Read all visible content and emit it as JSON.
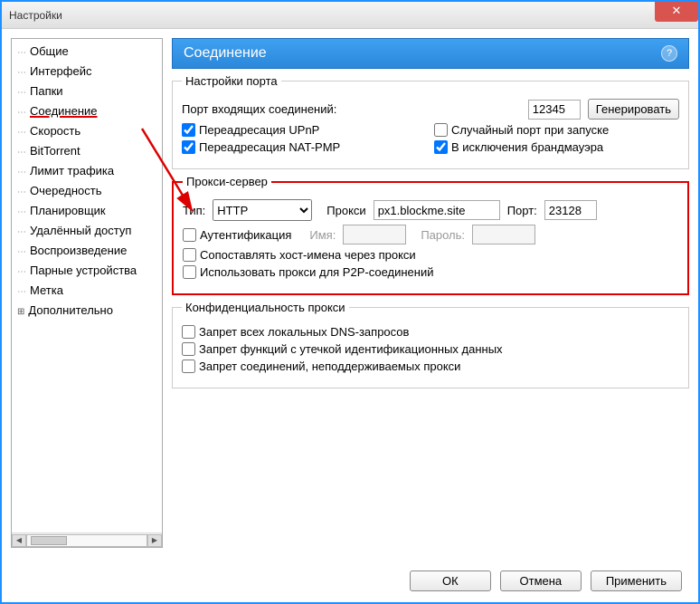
{
  "window": {
    "title": "Настройки",
    "close": "✕"
  },
  "tree": {
    "items": [
      "Общие",
      "Интерфейс",
      "Папки",
      "Соединение",
      "Скорость",
      "BitTorrent",
      "Лимит трафика",
      "Очередность",
      "Планировщик",
      "Удалённый доступ",
      "Воспроизведение",
      "Парные устройства",
      "Метка",
      "Дополнительно"
    ],
    "selected_index": 3
  },
  "header": {
    "title": "Соединение",
    "help": "?"
  },
  "port": {
    "legend": "Настройки порта",
    "incoming_label": "Порт входящих соединений:",
    "incoming_value": "12345",
    "generate_button": "Генерировать",
    "upnp_label": "Переадресация UPnP",
    "upnp_checked": true,
    "natpmp_label": "Переадресация NAT-PMP",
    "natpmp_checked": true,
    "random_port_label": "Случайный порт при запуске",
    "random_port_checked": false,
    "firewall_label": "В исключения брандмауэра",
    "firewall_checked": true
  },
  "proxy": {
    "legend": "Прокси-сервер",
    "type_label": "Тип:",
    "type_value": "HTTP",
    "host_label": "Прокси",
    "host_value": "px1.blockme.site",
    "port_label": "Порт:",
    "port_value": "23128",
    "auth_label": "Аутентификация",
    "auth_checked": false,
    "user_label": "Имя:",
    "user_value": "",
    "pass_label": "Пароль:",
    "pass_value": "",
    "resolve_label": "Сопоставлять хост-имена через прокси",
    "resolve_checked": false,
    "p2p_label": "Использовать прокси для P2P-соединений",
    "p2p_checked": false
  },
  "privacy": {
    "legend": "Конфиденциальность прокси",
    "dns_label": "Запрет всех локальных DNS-запросов",
    "dns_checked": false,
    "leak_label": "Запрет функций с утечкой идентификационных данных",
    "leak_checked": false,
    "unsupported_label": "Запрет соединений, неподдерживаемых прокси",
    "unsupported_checked": false
  },
  "buttons": {
    "ok": "ОК",
    "cancel": "Отмена",
    "apply": "Применить"
  }
}
